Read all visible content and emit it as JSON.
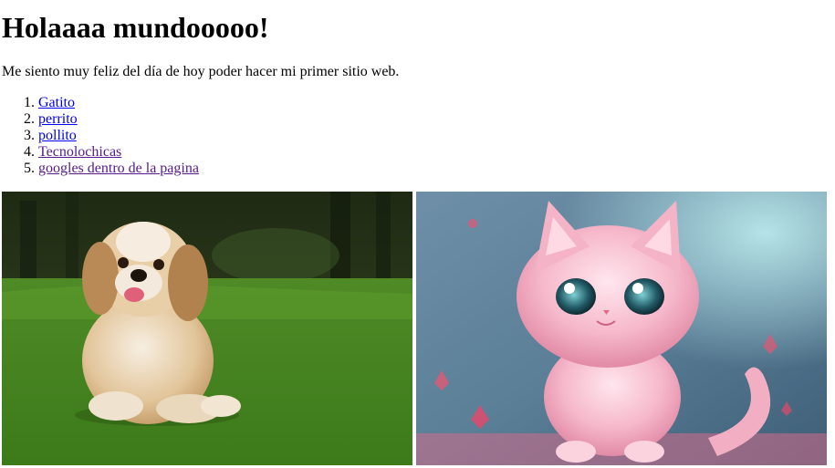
{
  "page": {
    "heading": "Holaaaa mundooooo!",
    "intro": "Me siento muy feliz del día de hoy poder hacer mi primer sitio web."
  },
  "links": [
    {
      "label": "Gatito",
      "visited": false
    },
    {
      "label": "perrito",
      "visited": false
    },
    {
      "label": "pollito",
      "visited": false
    },
    {
      "label": "Tecnolochicas",
      "visited": true
    },
    {
      "label": "googles dentro de la pagina",
      "visited": true
    }
  ],
  "images": [
    {
      "subject": "puppy-photo"
    },
    {
      "subject": "pink-kitten-illustration"
    }
  ],
  "colors": {
    "link": "#0000ee",
    "visited_link": "#551a8b"
  }
}
